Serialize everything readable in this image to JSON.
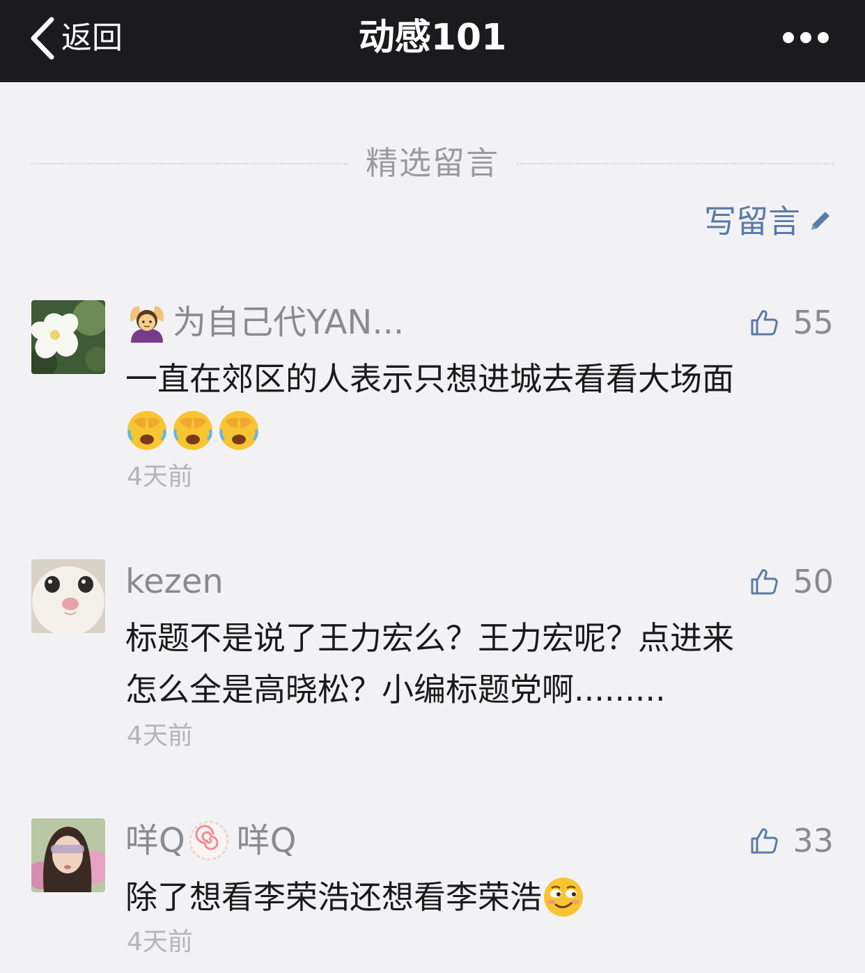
{
  "nav": {
    "back_label": "返回",
    "title": "动感101"
  },
  "section": {
    "title": "精选留言",
    "write_label": "写留言"
  },
  "comments": [
    {
      "avatar": "flower-photo",
      "nickname": "为自己代YAN...",
      "nickname_emoji": "woman-gesturing-ok",
      "likes": "55",
      "text": "一直在郊区的人表示只想进城去看看大场面",
      "text_emojis": [
        "face-palm-crying",
        "face-palm-crying",
        "face-palm-crying"
      ],
      "time": "4天前"
    },
    {
      "avatar": "white-cat-photo",
      "nickname": "kezen",
      "likes": "50",
      "text_line1": "标题不是说了王力宏么？王力宏呢？点进来",
      "text_line2": "怎么全是高晓松？小编标题党啊.........",
      "time": "4天前"
    },
    {
      "avatar": "woman-with-sunglasses-photo",
      "nickname_part1": "咩Q",
      "nickname_emoji": "fish-cake",
      "nickname_part2": "咩Q",
      "likes": "33",
      "text": "除了想看李荣浩还想看李荣浩",
      "text_emoji": "smirking-face",
      "time": "4天前"
    }
  ],
  "colors": {
    "topbar": "#1b1b1d",
    "background": "#f2f2f4",
    "link_blue": "#5a7aa8",
    "meta_gray": "#8a8a8f",
    "time_gray": "#b4b4b9"
  }
}
